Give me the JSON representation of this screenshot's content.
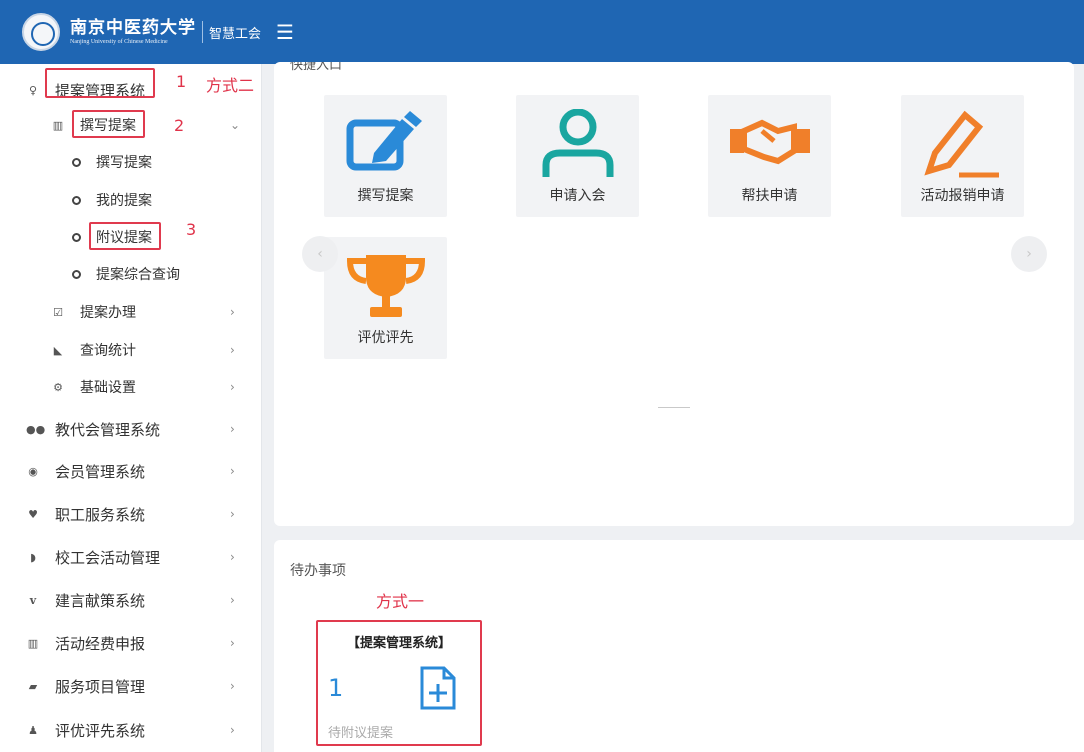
{
  "header": {
    "brand_cn": "南京中医药大学",
    "brand_en": "Nanjing University of Chinese Medicine",
    "subsystem": "智慧工会",
    "menu_icon": "hamburger-icon"
  },
  "sidebar": {
    "top": {
      "label": "提案管理系统",
      "icon": "lightbulb-icon"
    },
    "group": {
      "label": "撰写提案",
      "icon": "columns-icon"
    },
    "leaves": [
      {
        "label": "撰写提案"
      },
      {
        "label": "我的提案"
      },
      {
        "label": "附议提案"
      },
      {
        "label": "提案综合查询"
      }
    ],
    "subs": [
      {
        "label": "提案办理",
        "icon": "edit-icon"
      },
      {
        "label": "查询统计",
        "icon": "area-chart-icon"
      },
      {
        "label": "基础设置",
        "icon": "gear-icon"
      }
    ],
    "systems": [
      {
        "label": "教代会管理系统",
        "icon": "users-icon"
      },
      {
        "label": "会员管理系统",
        "icon": "user-circle-icon"
      },
      {
        "label": "职工服务系统",
        "icon": "heart-icon"
      },
      {
        "label": "校工会活动管理",
        "icon": "leaf-icon"
      },
      {
        "label": "建言献策系统",
        "icon": "v-icon"
      },
      {
        "label": "活动经费申报",
        "icon": "columns-icon"
      },
      {
        "label": "服务项目管理",
        "icon": "book-icon"
      },
      {
        "label": "评优评先系统",
        "icon": "person-icon"
      }
    ]
  },
  "annotations": {
    "n1": "1",
    "method2": "方式二",
    "n2": "2",
    "n3": "3",
    "method1": "方式一"
  },
  "quick_entry": {
    "title": "快捷入口",
    "tiles": [
      {
        "label": "撰写提案",
        "icon": "edit-document-icon",
        "color": "#2a8ad8"
      },
      {
        "label": "申请入会",
        "icon": "user-icon",
        "color": "#1aa6a0"
      },
      {
        "label": "帮扶申请",
        "icon": "handshake-icon",
        "color": "#f07f2a"
      },
      {
        "label": "活动报销申请",
        "icon": "pencil-icon",
        "color": "#f07f2a"
      },
      {
        "label": "评优评先",
        "icon": "trophy-icon",
        "color": "#f58a1f"
      }
    ]
  },
  "todo": {
    "title": "待办事项",
    "card": {
      "system": "【提案管理系统】",
      "count": "1",
      "desc": "待附议提案",
      "icon": "file-add-icon"
    }
  },
  "colors": {
    "header": "#1f66b3",
    "highlight": "#e03a4e",
    "accent": "#2a8ad8"
  }
}
